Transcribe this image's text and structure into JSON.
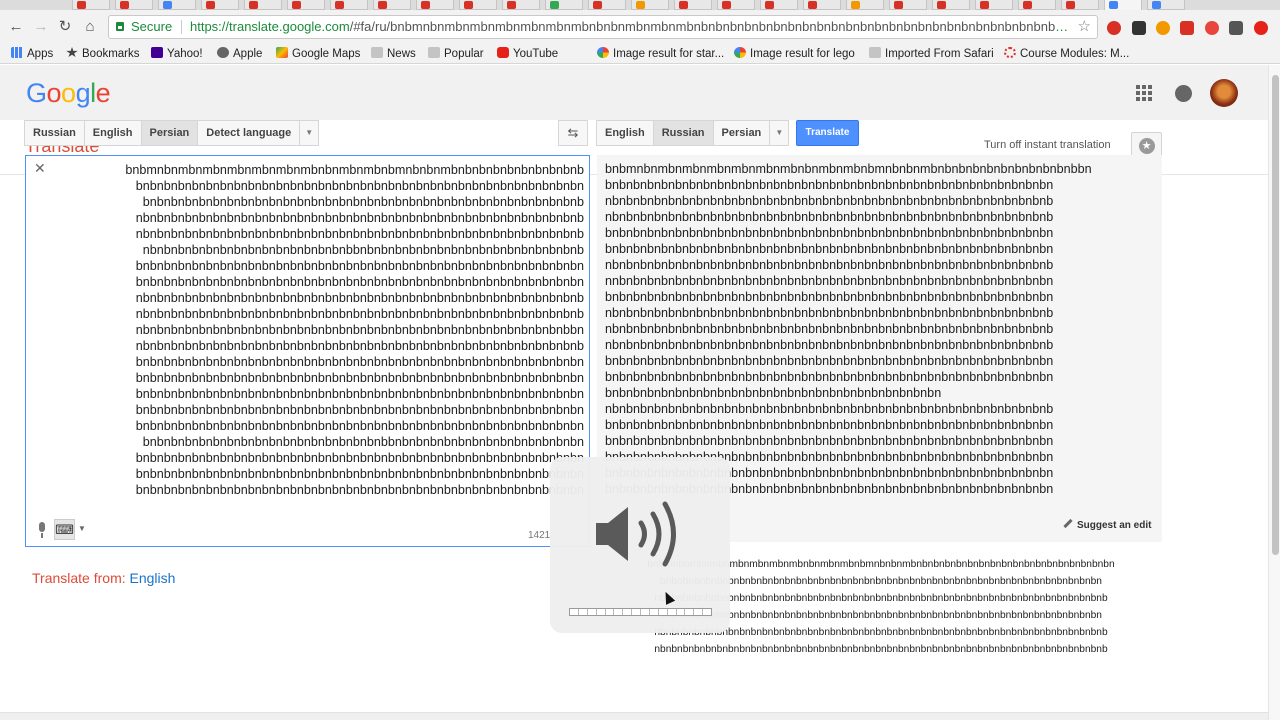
{
  "browser": {
    "omnibox": {
      "secure_label": "Secure",
      "url_host": "https://translate.google.com",
      "url_rest": "/#fa/ru/bnbmnbnmbnmbnmbnmbnmbnmbnbnbnmbnmbnmbnbnbnbnbnbnbnbnbnbnbnbnbnbnbnbnbnbnbnbnbnbnbnbnbnbnbnbnbnbnbnb..."
    },
    "bookmarks": [
      {
        "label": "Apps",
        "icon": "apps-grid-icon"
      },
      {
        "label": "Bookmarks",
        "icon": "star-icon"
      },
      {
        "label": "Yahoo!",
        "icon": "yahoo-icon"
      },
      {
        "label": "Apple",
        "icon": "apple-icon"
      },
      {
        "label": "Google Maps",
        "icon": "maps-icon"
      },
      {
        "label": "News",
        "icon": "folder-icon"
      },
      {
        "label": "Popular",
        "icon": "folder-icon"
      },
      {
        "label": "YouTube",
        "icon": "youtube-icon"
      },
      {
        "label": "Image result for star...",
        "icon": "google-icon"
      },
      {
        "label": "Image result for lego",
        "icon": "google-icon"
      },
      {
        "label": "Imported From Safari",
        "icon": "folder-icon"
      },
      {
        "label": "Course Modules: M...",
        "icon": "course-icon"
      }
    ],
    "colors": {
      "secure": "#1b8b3b",
      "youtube": "#e62117"
    }
  },
  "header": {
    "logo": [
      "G",
      "o",
      "o",
      "g",
      "l",
      "e"
    ],
    "logo_colors": [
      "#4285f4",
      "#ea4335",
      "#fbbc05",
      "#4285f4",
      "#34a853",
      "#ea4335"
    ]
  },
  "subheader": {
    "title": "Translate",
    "instant_toggle": "Turn off instant translation"
  },
  "source": {
    "languages": [
      "Russian",
      "English",
      "Persian",
      "Detect language"
    ],
    "selected": "Persian",
    "text": "bnbmnbnmbnmbnmbnmbnmbnmbnbnmbnmbnbmnbnbnmbnbnbnbnbnbnbnbnbnb\nbnbnbnbnbnbnbnbnbnbnbnbnbnbnbnbnbnbnbnbnbnbnbnbnbnbnbnbnbnbnbnbn\nbnbnbnbnbnbnbnbnbnbnbnbnbnbnbnbnbnbnbnbnbnbnbnbnbnbnbnbnbnbnbnb\nnbnbnbnbnbnbnbnbnbnbnbnbnbnbnbnbnbnbnbnbnbnbnbnbnbnbnbnbnbnbnbnb\nnbnbnbnbnbnbnbnbnbnbnbnbnbnbnbnbnbnbnbnbnbnbnbnbnbnbnbnbnbnbnbnb\nnbnbnbnbnbnbnbnbnbnbnbnbnbnbnbbnbnbnbnbnbnbnbnbnbnbnbnbnbnbnbnb\nbnbnbnbnbnbnbnbnbnbnbnbnbnbnbnbnbnbnbnbnbnbnbnbnbnbnbnbnbnbnbnbn\nbnbnbnbnbnbnbnbnbnbnbnbnbnbnbnbnbnbnbnbnbnbnbnbnbnbnbnbnbnbnbnbn\nnbnbnbnbnbnbnbnbnbnbnbnbnbnbnbnbnbnbnbnbnbnbnbnbnbnbnbnbnbnbnbnb\nnbnbnbnbnbnbnbnbnbnbnbnbnbnbnbnbnbnbnbnbnbnbnbnbnbnbnbnbnbnbnbnb\nnbnbnbnbnbnbnbnbnbnbnbnbnbnbnbnbnbnbnbnbnbnbnbnbnbnbnbnbnbnbnbbn\nnbnbnbnbnbnbnbnbnbnbnbnbnbnbnbnbnbnbnbnbnbnbnbnbnbnbnbnbnbnbnbnb\nbnbnbnbnbnbnbnbnbnbnbnbnbnbnbnbnbnbnbnbnbnbnbnbnbnbnbnbnbnbnbnbn\nbnbnbnbnbnbnbnbnbnbnbnbnbnbnbnbnbnbnbnbnbnbnbnbnbnbnbnbnbnbnbnbn\nbnbnbnbnbnbnbnbnbnbnbnbnbnbnbnbnbnbnbnbnbnbnbnbnbnbnbnbnbnbnbnbn\nbnbnbnbnbnbnbnbnbnbnbnbnbnbnbnbnbnbnbnbnbnbnbnbnbnbnbnbnbnbnbnbn\nbnbnbnbnbnbnbnbnbnbnbnbnbnbnbnbnbnbnbnbnbnbnbnbnbnbnbnbnbnbnbnbn\nbnbnbnbnbnbnbnbnbnbnbnbnbnbnbnbnbnbbnbnbnbnbnbnbnbnbnbnbnbnbnbn\nbnbnbnbnbnbnbnbnbnbnbnbnbnbnbnbnbnbnbnbnbnbnbnbnbnbnbnbnbnbnbnbn\nbnbnbnbnbnbnbnbnbnbnbnbnbnbnbnbnbnbnbnbnbnbnbnbnbnbnbnbnbnbnbnbn\nbnbnbnbnbnbnbnbnbnbnbnbnbnbnbnbnbnbnbnbnbnbnbnbnbnbnbnbnbnbnbnbn",
    "char_count": "1421",
    "translate_from_label": "Translate from:",
    "translate_from_lang": "English"
  },
  "target": {
    "languages": [
      "English",
      "Russian",
      "Persian"
    ],
    "selected": "Russian",
    "swap_icon": "swap-arrows-icon",
    "translate_button": "Translate",
    "text": "bnbmnbnmbnmbnmbnmbnmbnmbnbnmbnmbnbmnbnbnmbnbnbnbnbnbnbnbnbnbnbbn\nbnbnbnbnbnbnbnbnbnbnbnbnbnbnbnbnbnbnbnbnbnbnbnbnbnbnbnbnbnbnbnbn\nnbnbnbnbnbnbnbnbnbnbnbnbnbnbnbnbnbnbnbnbnbnbnbnbnbnbnbnbnbnbnbnb\nnbnbnbnbnbnbnbnbnbnbnbnbnbnbnbnbnbnbnbnbnbnbnbnbnbnbnbnbnbnbnbnb\nbnbnbnbnbnbnbnbnbnbnbnbnbnbnbnbnbnbnbnbnbnbnbnbnbnbnbnbnbnbnbnbn\nbnbnbnbnbnbnbnbnbnbnbnbnbnbnbnbnbnbnbnbnbnbnbnbnbnbnbnbnbnbnbnbn\nnbnbnbnbnbnbnbnbnbnbnbnbnbnbnbnbnbnbnbnbnbnbnbnbnbnbnbnbnbnbnbnb\nnnbnbnbnbnbnbnbnbnbnbnbnbnbnbnbnbnbnbnbnbnbnbnbnbnbnbnbnbnbnbnbn\nbnbnbnbnbnbnbnbnbnbnbnbnbnbnbnbnbnbnbnbnbnbnbnbnbnbnbnbnbnbnbnbn\nnbnbnbnbnbnbnbnbnbnbnbnbnbnbnbnbnbnbnbnbnbnbnbnbnbnbnbnbnbnbnbnb\nnbnbnbnbnbnbnbnbnbnbnbnbnbnbnbnbnbnbnbnbnbnbnbnbnbnbnbnbnbnbnbnb\nnbnbnbnbnbnbnbnbnbnbnbnbnbnbnbnbnbnbnbnbnbnbnbnbnbnbnbnbnbnbnbnb\nbnbnbnbnbnbnbnbnbnbnbnbnbnbnbnbnbnbnbnbnbnbnbnbnbnbnbnbnbnbnbnbn\nbnbnbnbnbnbnbnbnbnbnbnbnbnbnbnbnbnbnbnbnbnbnbnbnbnbnbnbnbnbnbnbn\nbnbnbnbnbnbnbnbnbnbnbnbnbnbnbnbnbnbnbnbnbnbnbnbn\nnbnbnbnbnbnbnbnbnbnbnbnbnbnbnbnbnbnbnbnbnbnbnbnbnbnbnbnbnbnbnbnb\nbnbnbnbnbnbnbnbnbnbnbnbnbnbnbnbnbnbnbnbnbnbnbnbnbnbnbnbnbnbnbnbn\nbnbnbnbnbnbnbnbnbnbnbnbnbnbnbnbnbnbnbnbnbnbnbnbnbnbnbnbnbnbnbnbn\nbnbnbnbnbnbnbnbnbnbnbnbnbnbnbnbnbnbnbnbnbnbnbnbnbnbnbnbnbnbnbnbn\nbnbnbnbnbnbnbnbnbnbnbnbnbnbnbnbnbnbnbnbnbnbnbnbnbnbnbnbnbnbnbnbn\nbnbnbnbnbnbnbnbnbnbnbnbnbnbnbnbnbnbnbnbnbnbnbnbnbnbnbnbnbnbnbnbn",
    "suggest_edit": "Suggest an edit",
    "alt_text": "bnbmnbnmbnmbnmbnmbnmbnmbnbnmbnmbnbmnbnbnmbnbnbnbnbnbnbnbnbnbnbnbnbnbnbnbnbnbn\nbnbnbnbnbnbnbnbnbnbnbnbnbnbnbnbnbnbnbnbnbnbnbnbnbnbnbnbnbnbnbnbnbnbnbnbnbnbnbn\nnbnbnbnbnbnbnbnbnbnbnbnbnbnbnbnbnbnbnbnbnbnbnbnbnbnbnbnbnbnbnbnbnbnbnbnbnbnbnbnb\nbnbnbnbnbnbnbnbnbnbnbnbnbnbnbnbnbnbnbnbnbnbnbnbnbnbnbnbnbnbnbnbnbnbnbnbnbnbnbn\nnbnbnbnbnbnbnbnbnbnbnbnbnbnbnbnbnbnbnbnbnbnbnbnbnbnbnbnbnbnbnbnbnbnbnbnbnbnbnbnb\nnbnbnbnbnbnbnbnbnbnbnbnbnbnbnbnbnbnbnbnbnbnbnbnbnbnbnbnbnbnbnbnbnbnbnbnbnbnbnbnb"
  },
  "volume_hud": {
    "icon": "speaker-volume-icon",
    "level_fraction": 0.0,
    "segments": 16
  }
}
